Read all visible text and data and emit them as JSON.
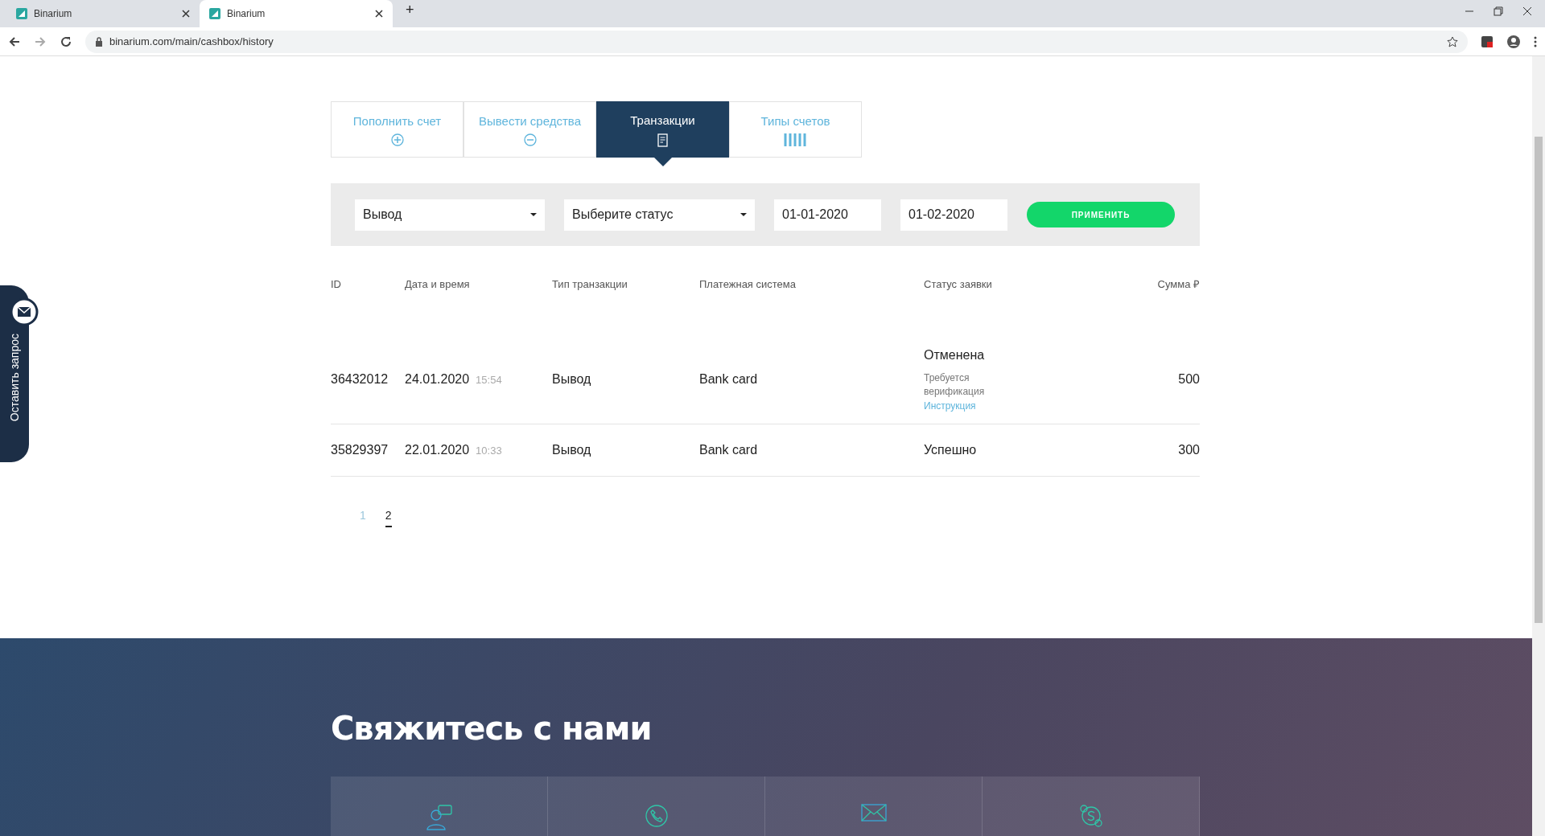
{
  "browser": {
    "tabs": [
      {
        "title": "Binarium",
        "selected": false
      },
      {
        "title": "Binarium",
        "selected": true
      }
    ],
    "new_tab": "+",
    "url": "binarium.com/main/cashbox/history"
  },
  "side_widget": {
    "label": "Оставить запрос"
  },
  "cashbox_tabs": [
    {
      "label": "Пополнить счет",
      "kind": "plus",
      "selected": false
    },
    {
      "label": "Вывести средства",
      "kind": "minus",
      "selected": false
    },
    {
      "label": "Транзакции",
      "kind": "document",
      "selected": true
    },
    {
      "label": "Типы счетов",
      "kind": "bars",
      "selected": false
    }
  ],
  "filters": {
    "type": "Вывод",
    "status": "Выберите статус",
    "date_from": "01-01-2020",
    "date_to": "01-02-2020",
    "apply": "ПРИМЕНИТЬ"
  },
  "table": {
    "columns": [
      "ID",
      "Дата и время",
      "Тип транзакции",
      "Платежная система",
      "Статус заявки",
      "Сумма ₽"
    ],
    "rows": [
      {
        "id": "36432012",
        "date": "24.01.2020",
        "time": "15:54",
        "type": "Вывод",
        "system": "Bank card",
        "status": "Отменена",
        "status_note": "Требуется верификация",
        "status_link": "Инструкция",
        "amount": "500"
      },
      {
        "id": "35829397",
        "date": "22.01.2020",
        "time": "10:33",
        "type": "Вывод",
        "system": "Bank card",
        "status": "Успешно",
        "amount": "300"
      }
    ]
  },
  "pagination": [
    {
      "label": "1",
      "selected": false
    },
    {
      "label": "2",
      "selected": true
    }
  ],
  "contact": {
    "title": "Свяжитесь с нами",
    "cards": [
      {
        "kind": "chat"
      },
      {
        "kind": "phone"
      },
      {
        "kind": "mail"
      },
      {
        "kind": "skype"
      }
    ]
  }
}
